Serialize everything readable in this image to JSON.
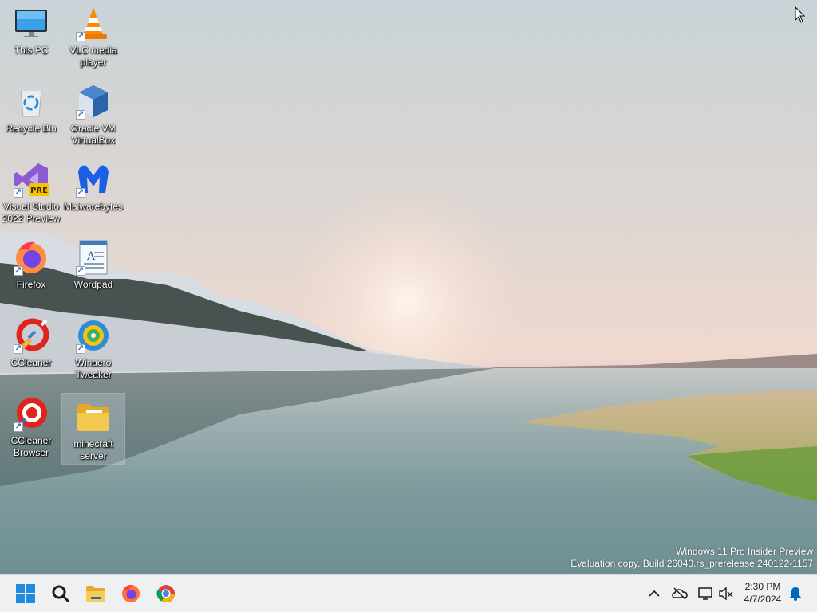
{
  "desktop": {
    "icons": [
      {
        "name": "This PC",
        "shortcut": false
      },
      {
        "name": "VLC media\nplayer",
        "shortcut": true
      },
      {
        "name": "Recycle Bin",
        "shortcut": false
      },
      {
        "name": "Oracle VM\nVirtualBox",
        "shortcut": true
      },
      {
        "name": "Visual Studio\n2022 Preview",
        "shortcut": true
      },
      {
        "name": "Malwarebytes",
        "shortcut": true
      },
      {
        "name": "Firefox",
        "shortcut": true
      },
      {
        "name": "Wordpad",
        "shortcut": true
      },
      {
        "name": "CCleaner",
        "shortcut": true
      },
      {
        "name": "Winaero\nTweaker",
        "shortcut": true
      },
      {
        "name": "CCleaner\nBrowser",
        "shortcut": true
      },
      {
        "name": "minecraft\nserver",
        "shortcut": false,
        "selected": true
      }
    ],
    "vs_badge": "PRE"
  },
  "watermark": {
    "line1": "Windows 11 Pro Insider Preview",
    "line2": "Evaluation copy. Build 26040.rs_prerelease.240122-1157"
  },
  "taskbar": {
    "pinned": [
      "start-icon",
      "search-icon",
      "file-explorer-icon",
      "firefox-icon",
      "chrome-icon"
    ],
    "tray": [
      "chevron-up-icon",
      "onedrive-offline-icon",
      "network-icon",
      "volume-muted-icon",
      "notification-bell-icon"
    ],
    "time": "2:30 PM",
    "date": "4/7/2024"
  },
  "colors": {
    "accent": "#0067c0",
    "taskbar_bg": "#eef0f2",
    "folder": "#f4c74f"
  }
}
